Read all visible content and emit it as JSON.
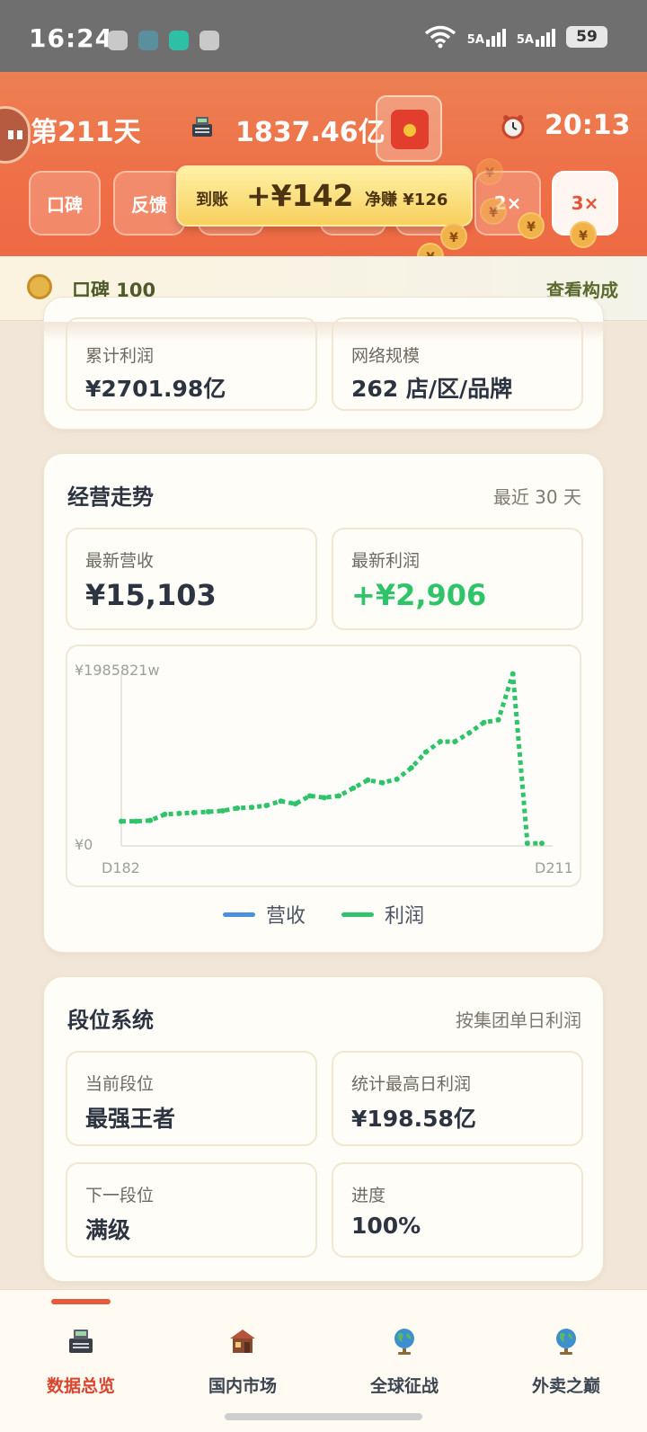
{
  "status_bar": {
    "time": "16:24",
    "signal1_label": "5A",
    "signal2_label": "5A",
    "battery": "59"
  },
  "header": {
    "day": "第211天",
    "money": "1837.46亿",
    "clock": "20:13",
    "chips": [
      "口碑",
      "反馈",
      "2×",
      "3×"
    ],
    "active_speed": "3×"
  },
  "toast": {
    "arrival_label": "到账",
    "amount": "+¥142",
    "net_label": "净赚 ¥126"
  },
  "floating_coin_symbol": "¥",
  "reputation": {
    "label": "口碑 100",
    "link": "查看构成"
  },
  "summary_card": {
    "left_label": "累计利润",
    "left_value": "¥2701.98亿",
    "right_label": "网络规模",
    "right_value": "262 店/区/品牌"
  },
  "trend_card": {
    "title": "经营走势",
    "range": "最近 30 天",
    "latest_revenue_label": "最新营收",
    "latest_revenue": "¥15,103",
    "latest_profit_label": "最新利润",
    "latest_profit": "+¥2,906",
    "legend": {
      "revenue": "营收",
      "profit": "利润"
    }
  },
  "chart_data": {
    "type": "line",
    "title": "",
    "x": [
      "D182",
      "D183",
      "D184",
      "D185",
      "D186",
      "D187",
      "D188",
      "D189",
      "D190",
      "D191",
      "D192",
      "D193",
      "D194",
      "D195",
      "D196",
      "D197",
      "D198",
      "D199",
      "D200",
      "D201",
      "D202",
      "D203",
      "D204",
      "D205",
      "D206",
      "D207",
      "D208",
      "D209",
      "D210",
      "D211"
    ],
    "x_tick_labels": [
      "D182",
      "D211"
    ],
    "y_tick_labels": [
      "¥1985821w",
      "¥0"
    ],
    "ylim": [
      0,
      1985821
    ],
    "y_unit": "w",
    "series": [
      {
        "name": "营收",
        "color": "#4a8fe0",
        "values": []
      },
      {
        "name": "利润",
        "color": "#2fc36a",
        "values": [
          283000,
          283000,
          293000,
          363000,
          373000,
          383000,
          393000,
          404000,
          434000,
          444000,
          464000,
          515000,
          484000,
          575000,
          555000,
          575000,
          665000,
          757000,
          727000,
          767000,
          898000,
          1080000,
          1200000,
          1200000,
          1300000,
          1420000,
          1450000,
          1980000,
          30000,
          30000
        ]
      }
    ],
    "grid": false,
    "legend_position": "bottom"
  },
  "rank_card": {
    "title": "段位系统",
    "subtitle": "按集团单日利润",
    "current_label": "当前段位",
    "current_value": "最强王者",
    "best_label": "统计最高日利润",
    "best_value": "¥198.58亿",
    "next_label": "下一段位",
    "next_value": "满级",
    "progress_label": "进度",
    "progress_value": "100%"
  },
  "bottom_nav": {
    "items": [
      "数据总览",
      "国内市场",
      "全球征战",
      "外卖之巅"
    ],
    "active": 0
  },
  "colors": {
    "header_orange": "#ef6f47",
    "profit_green": "#2fc36a",
    "revenue_blue": "#4a8fe0",
    "active_nav": "#d8462f"
  }
}
